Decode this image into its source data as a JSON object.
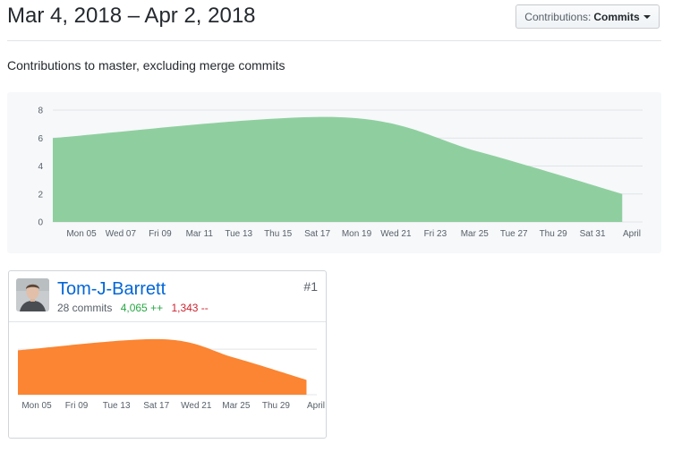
{
  "header": {
    "title": "Mar 4, 2018 – Apr 2, 2018",
    "contributions_prefix": "Contributions:",
    "contributions_value": "Commits"
  },
  "subtitle": "Contributions to master, excluding merge commits",
  "chart_data": [
    {
      "type": "area",
      "color": "#8fcf9f",
      "ylim": [
        0,
        8
      ],
      "yticks": [
        0,
        2,
        4,
        6,
        8
      ],
      "x_range": [
        "2018-03-04",
        "2018-04-02"
      ],
      "xticks": [
        "Mon 05",
        "Wed 07",
        "Fri 09",
        "Mar 11",
        "Tue 13",
        "Thu 15",
        "Sat 17",
        "Mon 19",
        "Wed 21",
        "Fri 23",
        "Mar 25",
        "Tue 27",
        "Thu 29",
        "Sat 31",
        "April"
      ],
      "x": [
        "2018-03-04",
        "2018-03-18",
        "2018-03-25",
        "2018-04-01"
      ],
      "values": [
        6,
        7.5,
        5,
        2
      ],
      "grid": true
    },
    {
      "type": "area",
      "color": "#fb8532",
      "xticks": [
        "Mon 05",
        "Fri 09",
        "Tue 13",
        "Sat 17",
        "Wed 21",
        "Mar 25",
        "Thu 29",
        "April"
      ],
      "x_range": [
        "2018-03-04",
        "2018-04-02"
      ],
      "x": [
        "2018-03-04",
        "2018-03-18",
        "2018-03-25",
        "2018-04-01"
      ],
      "values": [
        6,
        7.5,
        5,
        2
      ],
      "grid": true
    }
  ],
  "contributor": {
    "username": "Tom-J-Barrett",
    "commits": "28 commits",
    "additions": "4,065 ++",
    "deletions": "1,343 --",
    "rank": "#1"
  }
}
